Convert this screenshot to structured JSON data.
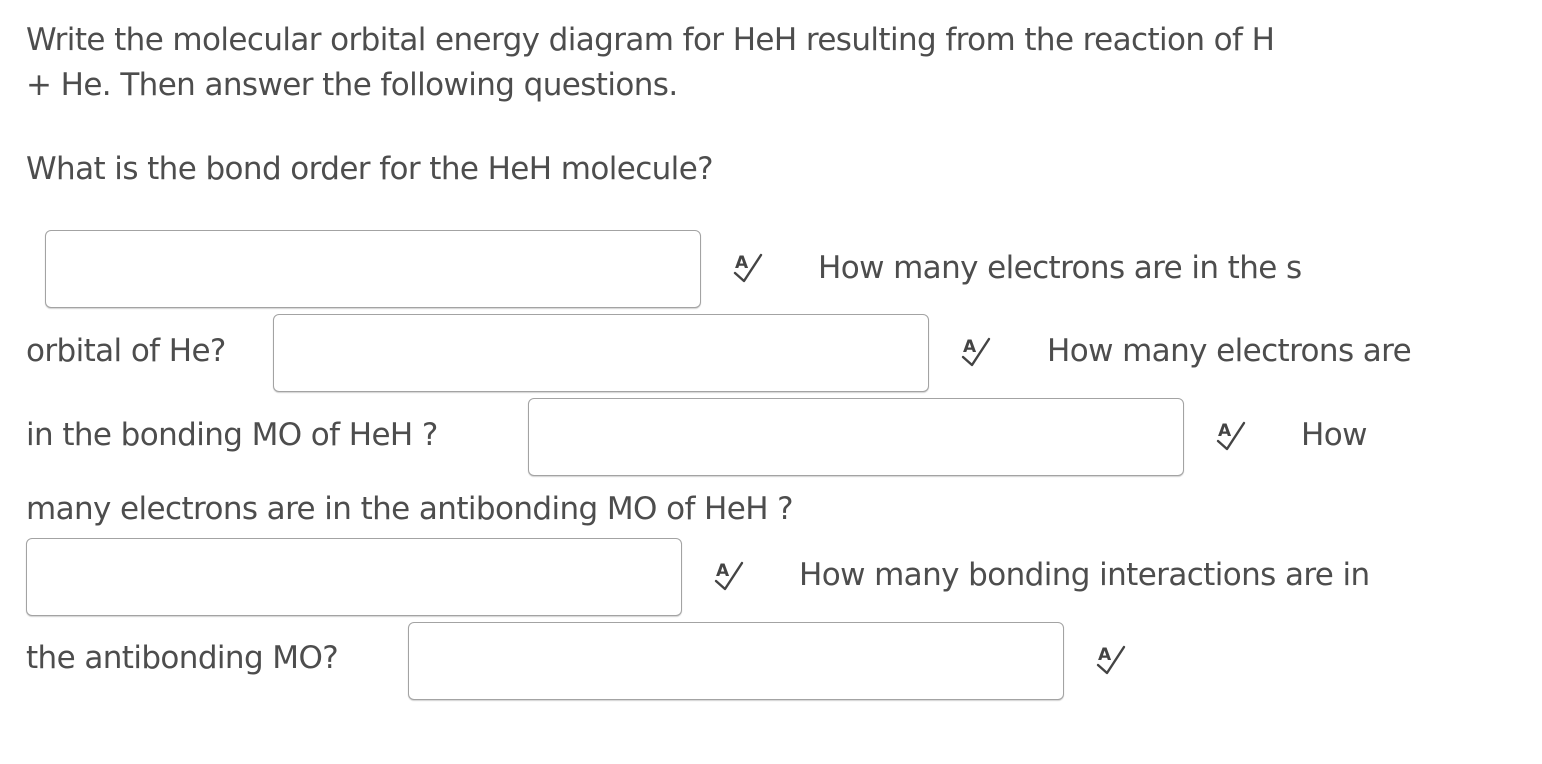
{
  "question": {
    "intro_line1": "Write the molecular orbital energy diagram for HeH resulting from the reaction of H",
    "intro_line2": "+ He.  Then answer the following questions.",
    "q1": "What is the bond order for the HeH  molecule?",
    "q2_part1": "How many electrons are in the s",
    "q2_part2": "orbital of He?",
    "q3_part1": "How many electrons are",
    "q3_part2": "in the bonding MO of HeH ?",
    "q4_part1": "How",
    "q4_part2": "many electrons are in the antibonding MO of HeH ?",
    "q5_part1": "How many bonding interactions are in",
    "q5_part2": "the antibonding MO?"
  },
  "answers": {
    "a1": "",
    "a2": "",
    "a3": "",
    "a4": "",
    "a5": ""
  },
  "icons": {
    "spell_check": "spell-check-icon"
  },
  "colors": {
    "text": "#4d4d4d",
    "box_border": "#a3a3a3"
  }
}
